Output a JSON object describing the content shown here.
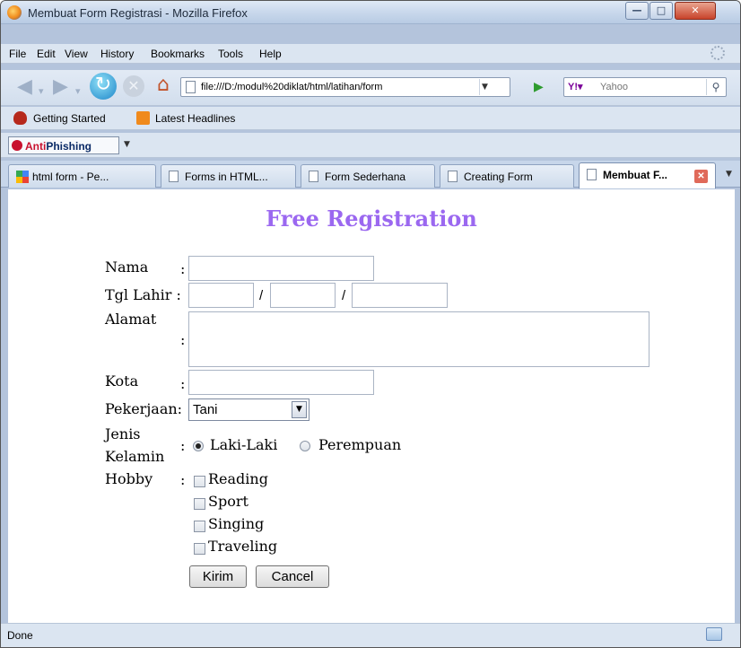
{
  "window": {
    "title": "Membuat Form Registrasi - Mozilla Firefox"
  },
  "menubar": {
    "items": [
      {
        "label": "File"
      },
      {
        "label": "Edit"
      },
      {
        "label": "View"
      },
      {
        "label": "History"
      },
      {
        "label": "Bookmarks"
      },
      {
        "label": "Tools"
      },
      {
        "label": "Help"
      }
    ]
  },
  "navigation": {
    "url": "file:///D:/modul%20diklat/html/latihan/form",
    "search_placeholder": "Yahoo",
    "search_engine": "Y!"
  },
  "bookmarks": {
    "items": [
      {
        "label": "Getting Started"
      },
      {
        "label": "Latest Headlines"
      }
    ]
  },
  "toolbar": {
    "antiphishing_prefix": "Anti",
    "antiphishing_suffix": "Phishing"
  },
  "tabs": [
    {
      "label": "html form - Pe..."
    },
    {
      "label": "Forms in HTML..."
    },
    {
      "label": "Form Sederhana"
    },
    {
      "label": "Creating Form"
    },
    {
      "label": "Membuat F...",
      "active": true
    }
  ],
  "form": {
    "title": "Free Registration",
    "nama_label": "Nama",
    "tgl_lahir_label": "Tgl Lahir :",
    "alamat_label": "Alamat",
    "kota_label": "Kota",
    "pekerjaan_label": "Pekerjaan:",
    "pekerjaan_value": "Tani",
    "jenis_label_1": "Jenis",
    "jenis_label_2": "Kelamin",
    "gender_options": [
      "Laki-Laki",
      "Perempuan"
    ],
    "gender_selected": "Laki-Laki",
    "hobby_label": "Hobby",
    "hobbies": [
      "Reading",
      "Sport",
      "Singing",
      "Traveling"
    ],
    "colon": ":",
    "slash": "/",
    "submit_label": "Kirim",
    "cancel_label": "Cancel"
  },
  "status": {
    "text": "Done"
  },
  "colors": {
    "title": "#9b68f0",
    "chrome": "#dbe5f1",
    "close_button": "#c8432b"
  }
}
